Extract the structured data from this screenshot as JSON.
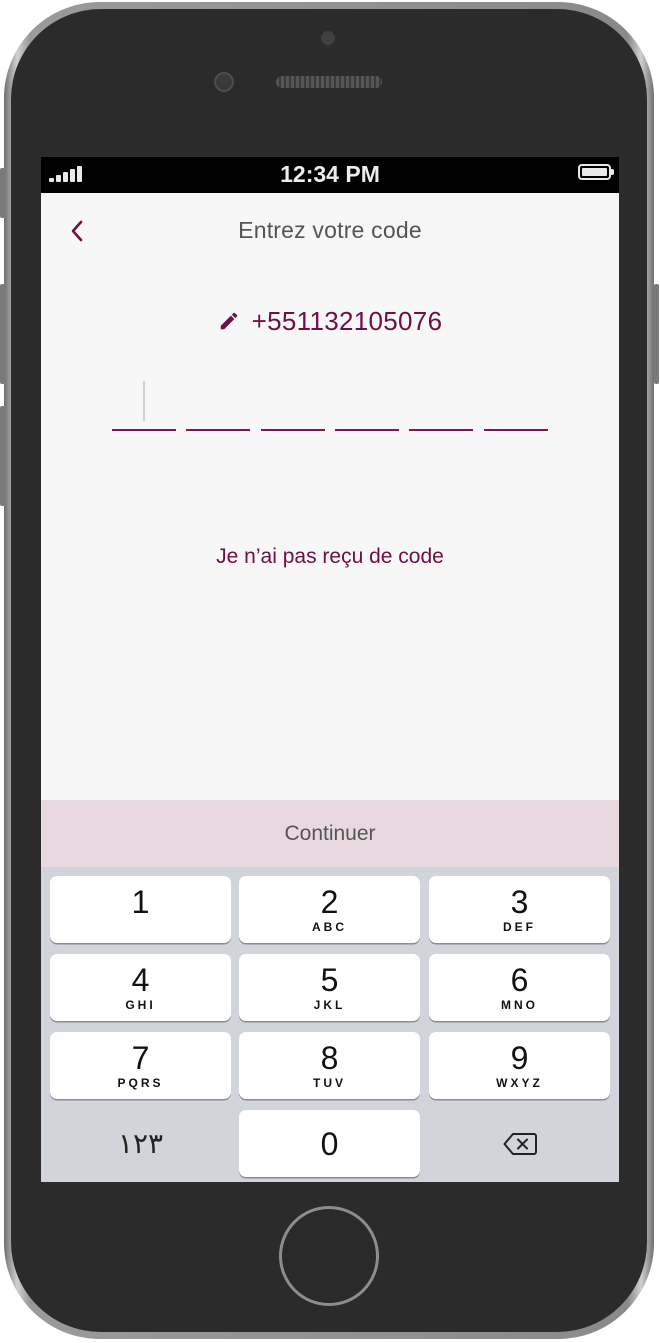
{
  "statusbar": {
    "time": "12:34 PM"
  },
  "header": {
    "title": "Entrez votre code",
    "back_icon": "chevron-left-icon"
  },
  "verification": {
    "phone_number": "+551132105076",
    "edit_icon": "pencil-icon",
    "code_length": 6,
    "code_digits": [
      "",
      "",
      "",
      "",
      "",
      ""
    ]
  },
  "resend_link": "Je n’ai pas reçu de code",
  "continue_button": "Continuer",
  "colors": {
    "accent": "#6e0f48",
    "continue_bg": "#e8d9e0",
    "screen_bg": "#f7f7f7",
    "keyboard_bg": "#d1d4da"
  },
  "keypad": {
    "keys": [
      {
        "digit": "1",
        "letters": ""
      },
      {
        "digit": "2",
        "letters": "ABC"
      },
      {
        "digit": "3",
        "letters": "DEF"
      },
      {
        "digit": "4",
        "letters": "GHI"
      },
      {
        "digit": "5",
        "letters": "JKL"
      },
      {
        "digit": "6",
        "letters": "MNO"
      },
      {
        "digit": "7",
        "letters": "PQRS"
      },
      {
        "digit": "8",
        "letters": "TUV"
      },
      {
        "digit": "9",
        "letters": "WXYZ"
      },
      {
        "digit": "0",
        "letters": ""
      }
    ],
    "symbols_key": "١٢٣",
    "delete_icon": "backspace-icon"
  }
}
